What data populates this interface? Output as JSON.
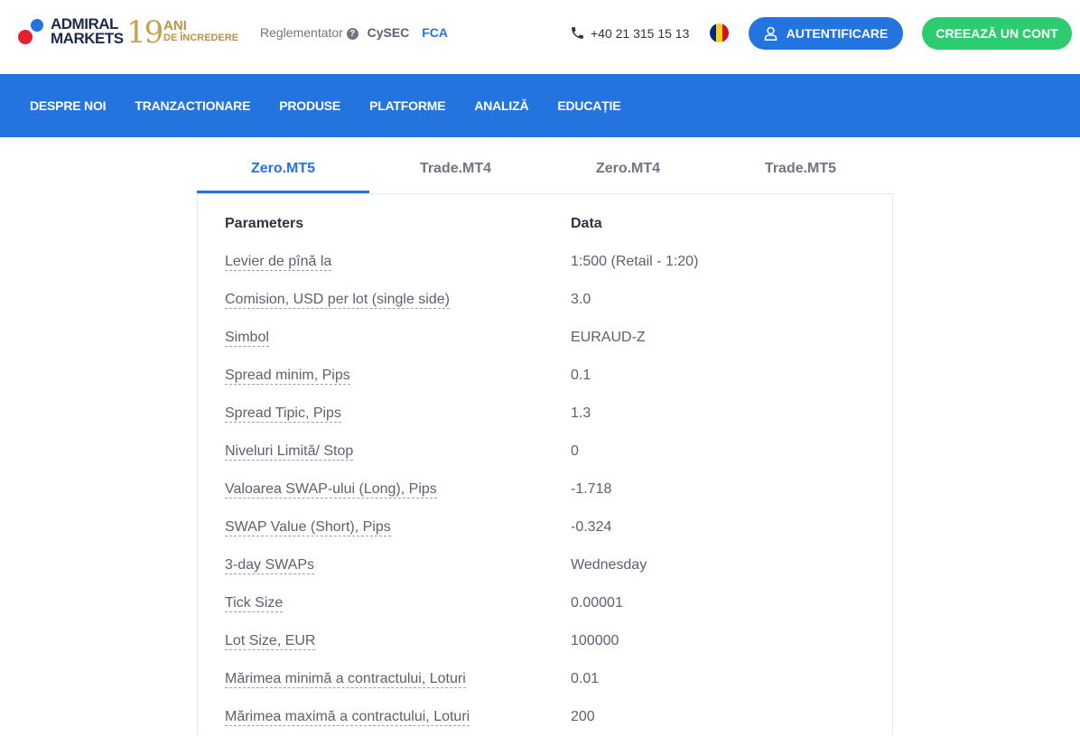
{
  "header": {
    "logo_text": "ADMIRAL\nMARKETS",
    "years_number": "19",
    "years_text_1": "ANI",
    "years_text_2": "DE ÎNCREDERE",
    "regulator_label": "Reglementator",
    "regulator_1": "CySEC",
    "regulator_2": "FCA",
    "phone": "+40 21 315 15 13",
    "flag_colors": [
      "#002b7f",
      "#fcd116",
      "#ce1126"
    ],
    "login_label": "AUTENTIFICARE",
    "signup_label": "CREEAZĂ UN CONT"
  },
  "nav": {
    "items": [
      "DESPRE NOI",
      "TRANZACTIONARE",
      "PRODUSE",
      "PLATFORME",
      "ANALIZĂ",
      "EDUCAȚIE"
    ]
  },
  "tabs": [
    "Zero.MT5",
    "Trade.MT4",
    "Zero.MT4",
    "Trade.MT5"
  ],
  "table": {
    "header": {
      "param": "Parameters",
      "value": "Data"
    },
    "rows": [
      {
        "param": "Levier de pînă la",
        "value": "1:500 (Retail - 1:20)"
      },
      {
        "param": "Comision, USD per lot (single side)",
        "value": "3.0"
      },
      {
        "param": "Simbol",
        "value": "EURAUD-Z"
      },
      {
        "param": "Spread minim, Pips",
        "value": "0.1"
      },
      {
        "param": "Spread Tipic, Pips",
        "value": "1.3"
      },
      {
        "param": "Niveluri Limită/ Stop",
        "value": "0"
      },
      {
        "param": "Valoarea SWAP-ului (Long), Pips",
        "value": "-1.718"
      },
      {
        "param": "SWAP Value (Short), Pips",
        "value": "-0.324"
      },
      {
        "param": "3-day SWAPs",
        "value": "Wednesday"
      },
      {
        "param": "Tick Size",
        "value": "0.00001"
      },
      {
        "param": "Lot Size, EUR",
        "value": "100000"
      },
      {
        "param": "Mărimea minimă a contractului, Loturi",
        "value": "0.01"
      },
      {
        "param": "Mărimea maximă a contractului, Loturi",
        "value": "200"
      }
    ]
  }
}
